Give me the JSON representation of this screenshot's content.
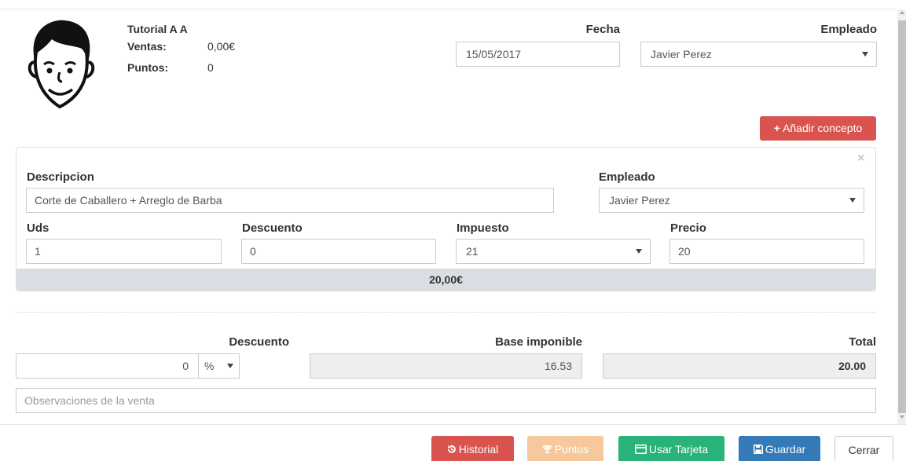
{
  "client": {
    "name": "Tutorial A A",
    "sales_label": "Ventas:",
    "sales_value": "0,00€",
    "points_label": "Puntos:",
    "points_value": "0"
  },
  "header": {
    "date_label": "Fecha",
    "date_value": "15/05/2017",
    "employee_label": "Empleado",
    "employee_value": "Javier Perez"
  },
  "add_concept_label": "Añadir concepto",
  "concept": {
    "description_label": "Descripcion",
    "description_value": "Corte de Caballero + Arreglo de Barba",
    "employee_label": "Empleado",
    "employee_value": "Javier Perez",
    "units_label": "Uds",
    "units_value": "1",
    "discount_label": "Descuento",
    "discount_value": "0",
    "tax_label": "Impuesto",
    "tax_value": "21",
    "price_label": "Precio",
    "price_value": "20",
    "subtotal": "20,00€",
    "close_glyph": "×"
  },
  "totals": {
    "discount_label": "Descuento",
    "discount_value": "0",
    "discount_unit": "%",
    "base_label": "Base imponible",
    "base_value": "16.53",
    "total_label": "Total",
    "total_value": "20.00"
  },
  "notes_placeholder": "Observaciones de la venta",
  "footer": {
    "historial": "Historial",
    "puntos": "Puntos",
    "usar_tarjeta": "Usar Tarjeta",
    "guardar": "Guardar",
    "cerrar": "Cerrar"
  },
  "icons": {
    "add": "plus-icon",
    "history": "history-icon",
    "points": "trophy-icon",
    "card": "credit-card-icon",
    "save": "save-icon"
  },
  "colors": {
    "danger": "#d9534f",
    "warning": "#f7c89b",
    "success": "#2ab27b",
    "primary": "#337ab7"
  }
}
